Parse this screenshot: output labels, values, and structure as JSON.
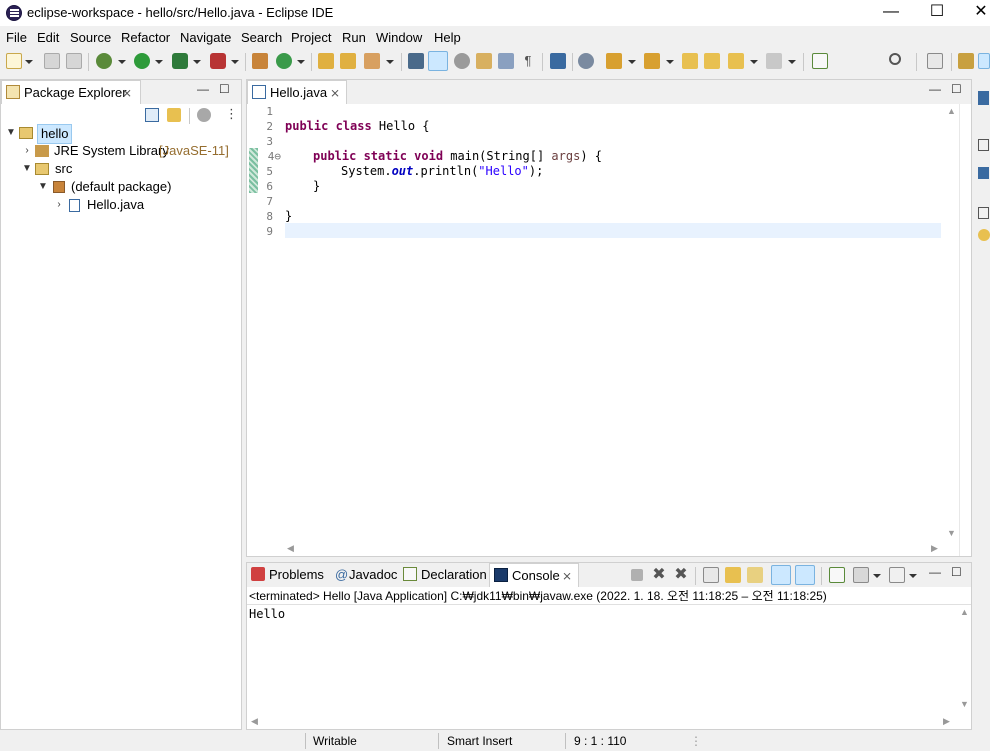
{
  "window": {
    "title": "eclipse-workspace - hello/src/Hello.java - Eclipse IDE",
    "minimize": "—",
    "maximize": "☐",
    "close": "✕"
  },
  "menu": [
    "File",
    "Edit",
    "Source",
    "Refactor",
    "Navigate",
    "Search",
    "Project",
    "Run",
    "Window",
    "Help"
  ],
  "package_explorer": {
    "title": "Package Explorer",
    "close": "⨯",
    "tree": [
      {
        "label": "hello",
        "suffix": ""
      },
      {
        "label": "JRE System Library",
        "suffix": "[JavaSE-11]"
      },
      {
        "label": "src",
        "suffix": ""
      },
      {
        "label": "(default package)",
        "suffix": ""
      },
      {
        "label": "Hello.java",
        "suffix": ""
      }
    ]
  },
  "editor": {
    "tab_label": "Hello.java",
    "close": "⨯",
    "line_numbers": [
      "1",
      "2",
      "3",
      "4⊖",
      "5",
      "6",
      "7",
      "8",
      "9"
    ],
    "code": {
      "l2_kw": "public class",
      "l2_rest": " Hello {",
      "l4_kw": "public static void",
      "l4_rest": " main(String[] ",
      "l4_var": "args",
      "l4_end": ") {",
      "l5_a": "System.",
      "l5_fld": "out",
      "l5_b": ".println(",
      "l5_str": "\"Hello\"",
      "l5_c": ");",
      "l6": "}",
      "l8": "}"
    }
  },
  "console_view": {
    "tabs": [
      "Problems",
      "Javadoc",
      "Declaration",
      "Console"
    ],
    "javadoc_prefix": "@",
    "close": "⨯",
    "header": "<terminated> Hello [Java Application] C:₩jdk11₩bin₩javaw.exe  (2022. 1. 18. 오전 11:18:25 – 오전 11:18:25)",
    "output": "Hello"
  },
  "status": {
    "writable": "Writable",
    "insert_mode": "Smart Insert",
    "position": "9 : 1 : 110"
  },
  "colors": {
    "keyword": "#7f0055",
    "string": "#2a00ff",
    "field": "#0000c0",
    "current_line": "#e8f2fe",
    "selection_bg": "#cce8ff"
  }
}
